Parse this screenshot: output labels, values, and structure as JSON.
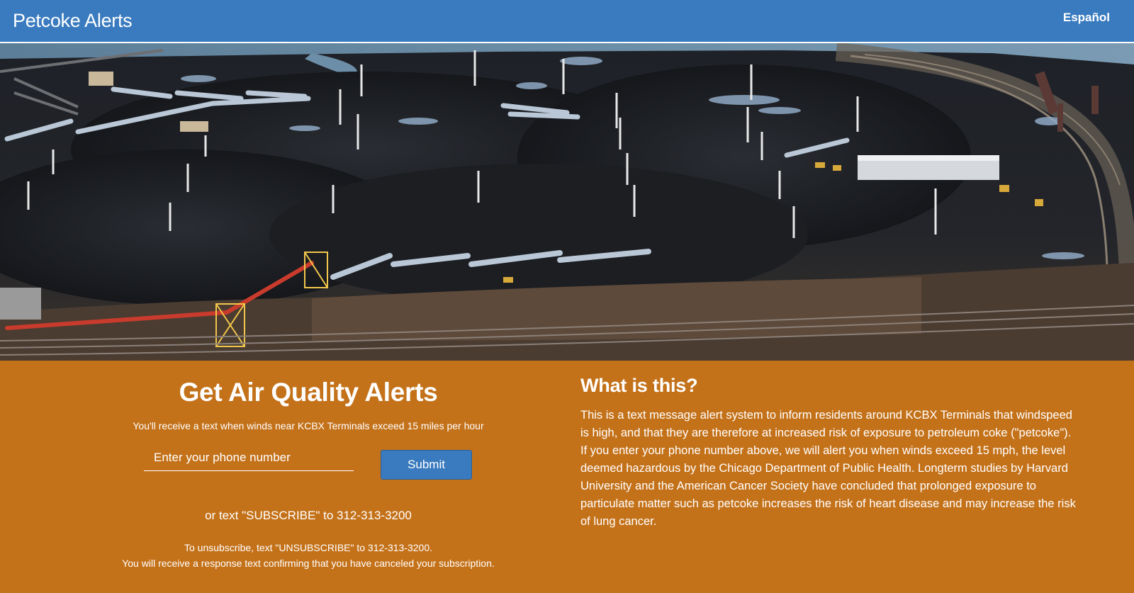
{
  "navbar": {
    "brand": "Petcoke Alerts",
    "language_link": "Español",
    "background_color": "#3a7bbf"
  },
  "hero": {
    "image_description_icon": "aerial-petcoke-terminal-photo"
  },
  "signup": {
    "title": "Get Air Quality Alerts",
    "subtitle": "You'll receive a text when winds near KCBX Terminals exceed 15 miles per hour",
    "phone_placeholder": "Enter your phone number",
    "phone_value": "",
    "submit_label": "Submit",
    "sms_text": "or text \"SUBSCRIBE\" to 312-313-3200",
    "unsubscribe_line1": "To unsubscribe, text \"UNSUBSCRIBE\" to 312-313-3200.",
    "unsubscribe_line2": "You will receive a response text confirming that you have canceled your subscription."
  },
  "info": {
    "title": "What is this?",
    "body": "This is a text message alert system to inform residents around KCBX Terminals that windspeed is high, and that they are therefore at increased risk of exposure to petroleum coke (\"petcoke\"). If you enter your phone number above, we will alert you when winds exceed 15 mph, the level deemed hazardous by the Chicago Department of Public Health. Longterm studies by Harvard University and the American Cancer Society have concluded that prolonged exposure to particulate matter such as petcoke increases the risk of heart disease and may increase the risk of lung cancer."
  },
  "colors": {
    "accent_orange": "#c4721a",
    "button_blue": "#3a7bbf"
  }
}
